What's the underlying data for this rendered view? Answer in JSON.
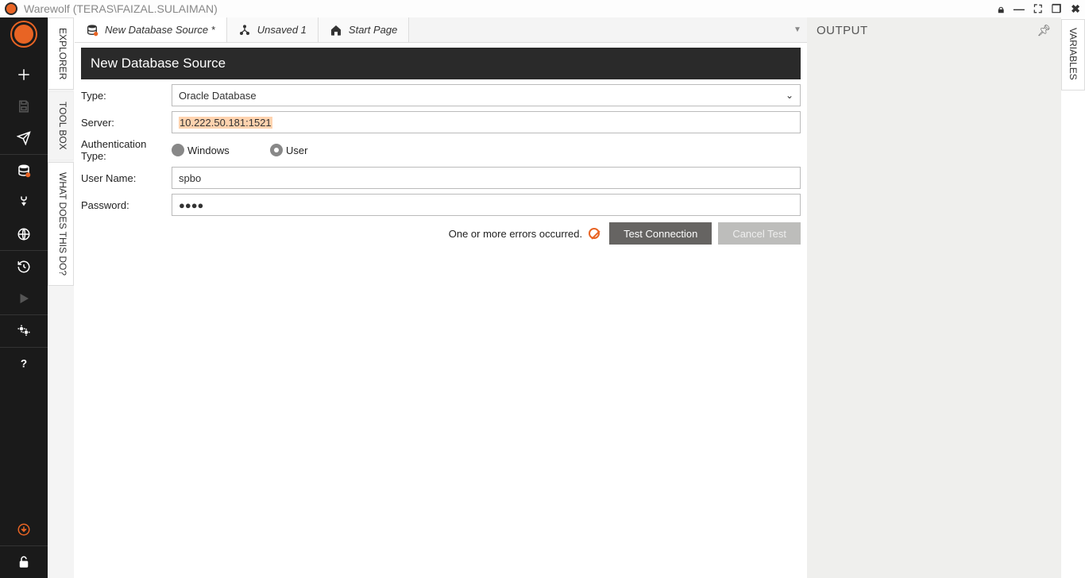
{
  "titlebar": {
    "title": "Warewolf (TERAS\\FAIZAL.SULAIMAN)"
  },
  "sideTabs": {
    "explorer": "EXPLORER",
    "toolbox": "TOOL BOX",
    "whatdoes": "WHAT DOES THIS DO?"
  },
  "docTabs": {
    "t0": "New Database Source *",
    "t1": "Unsaved 1",
    "t2": "Start Page"
  },
  "form": {
    "header": "New Database Source",
    "labels": {
      "type": "Type:",
      "server": "Server:",
      "auth": "Authentication Type:",
      "user": "User Name:",
      "pass": "Password:"
    },
    "typeValue": "Oracle Database",
    "serverValue": "10.222.50.181:1521",
    "authOptions": {
      "windows": "Windows",
      "user": "User"
    },
    "userValue": "spbo",
    "passValue": "●●●●",
    "error": "One or more errors occurred.",
    "testBtn": "Test Connection",
    "cancelBtn": "Cancel Test"
  },
  "output": {
    "title": "OUTPUT"
  },
  "variables": {
    "title": "VARIABLES"
  }
}
